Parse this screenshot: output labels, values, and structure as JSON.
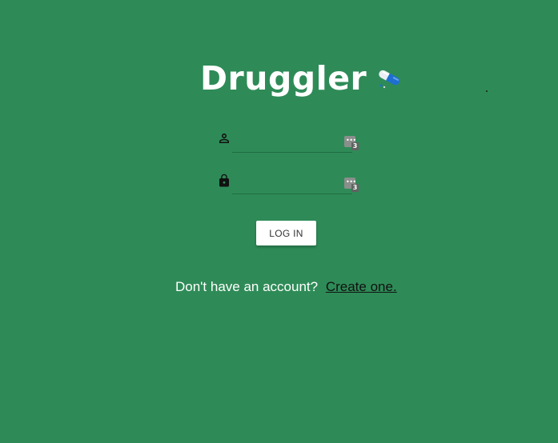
{
  "app": {
    "title": "Druggler",
    "title_icon": "pill-icon"
  },
  "login_form": {
    "username": {
      "value": "",
      "icon": "person-icon",
      "manager_badge_count": "3"
    },
    "password": {
      "value": "",
      "icon": "lock-icon",
      "manager_badge_count": "3"
    },
    "login_button_label": "LOG IN"
  },
  "signup_prompt": {
    "text": "Don't have an account?",
    "link_label": "Create one."
  },
  "colors": {
    "background": "#2e8b57",
    "title": "#ffffff",
    "link": "#111111"
  }
}
